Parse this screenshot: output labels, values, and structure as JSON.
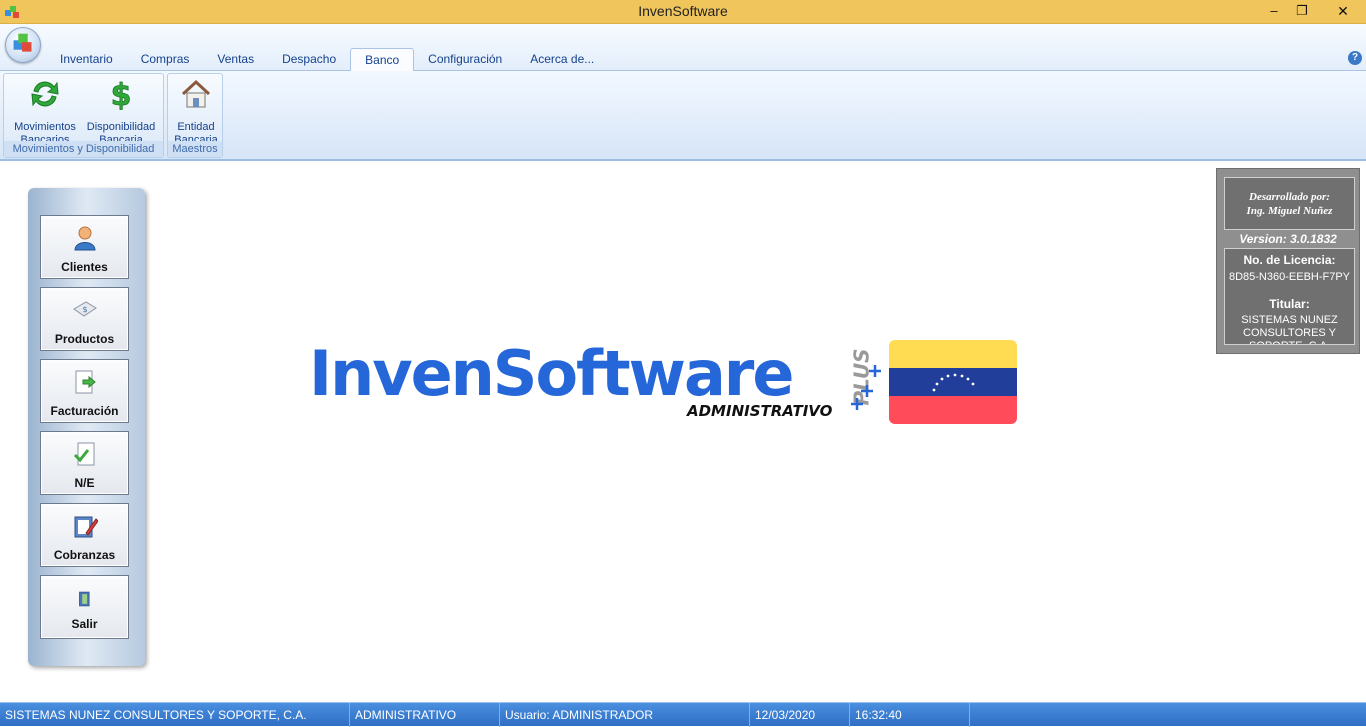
{
  "window": {
    "title": "InvenSoftware",
    "minimize_glyph": "–",
    "maximize_glyph": "❐",
    "close_glyph": "✕"
  },
  "ribbon": {
    "tabs": [
      {
        "label": "Inventario"
      },
      {
        "label": "Compras"
      },
      {
        "label": "Ventas"
      },
      {
        "label": "Despacho"
      },
      {
        "label": "Banco",
        "active": true
      },
      {
        "label": "Configuración"
      },
      {
        "label": "Acerca de..."
      }
    ],
    "help_glyph": "?",
    "groups": [
      {
        "label": "Movimientos y Disponibilidad",
        "buttons": [
          {
            "line1": "Movimientos",
            "line2": "Bancarios",
            "icon": "refresh-arrows-icon"
          },
          {
            "line1": "Disponibilidad",
            "line2": "Bancaria",
            "icon": "dollar-icon"
          }
        ]
      },
      {
        "label": "Maestros",
        "buttons": [
          {
            "line1": "Entidad",
            "line2": "Bancaria",
            "icon": "house-icon"
          }
        ]
      }
    ]
  },
  "sidebar": {
    "buttons": [
      {
        "label": "Clientes",
        "icon": "user-icon"
      },
      {
        "label": "Productos",
        "icon": "product-icon"
      },
      {
        "label": "Facturación",
        "icon": "invoice-icon"
      },
      {
        "label": "N/E",
        "icon": "checked-document-icon"
      },
      {
        "label": "Cobranzas",
        "icon": "clipboard-pen-icon"
      },
      {
        "label": "Salir",
        "icon": "exit-door-icon"
      }
    ]
  },
  "logo": {
    "title": "InvenSoftware",
    "subtitle": "ADMINISTRATIVO",
    "plus": "PLUS"
  },
  "info_panel": {
    "developed_by": "Desarrollado por:",
    "developer": "Ing. Miguel Nuñez",
    "version": "Version: 3.0.1832",
    "license_label": "No. de Licencia:",
    "license_value": "8D85-N360-EEBH-F7PY",
    "holder_label": "Titular:",
    "holder_value": "SISTEMAS NUNEZ CONSULTORES Y SOPORTE, C.A."
  },
  "statusbar": {
    "company": "SISTEMAS NUNEZ CONSULTORES Y SOPORTE, C.A.",
    "module": "ADMINISTRATIVO",
    "user": "Usuario: ADMINISTRADOR",
    "date": "12/03/2020",
    "time": "16:32:40"
  },
  "colors": {
    "titlebar": "#f0c65c",
    "ribbon_text": "#15428b",
    "statusbar": "#3a7fd4",
    "logo_blue": "#2566d8"
  }
}
